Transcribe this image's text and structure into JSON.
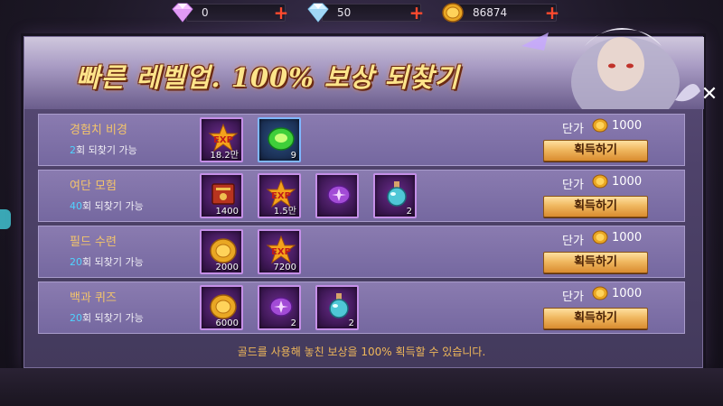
{
  "currencies": [
    {
      "name": "crystal",
      "icon": "pink-crystal-icon",
      "value": "0"
    },
    {
      "name": "diamond",
      "icon": "diamond-icon",
      "value": "50"
    },
    {
      "name": "gold",
      "icon": "gold-coin-icon",
      "value": "86874"
    }
  ],
  "title": "빠른 레벨업. 100% 보상 되찾기",
  "close_label": "✕",
  "price_label": "단가",
  "button_label": "획득하기",
  "rows": [
    {
      "name": "경험치 비경",
      "count": "2",
      "count_suffix": "회 되찾기 가능",
      "price": "1000",
      "items": [
        {
          "icon": "exp-star-icon",
          "qty": "18.2만",
          "rarity": "purple"
        },
        {
          "icon": "green-gem-icon",
          "qty": "9",
          "rarity": "blue"
        }
      ]
    },
    {
      "name": "여단 모험",
      "count": "40",
      "count_suffix": "회 되찾기 가능",
      "price": "1000",
      "items": [
        {
          "icon": "red-book-icon",
          "qty": "1400",
          "rarity": "purple"
        },
        {
          "icon": "exp-star-icon",
          "qty": "1.5만",
          "rarity": "purple"
        },
        {
          "icon": "purple-orb-icon",
          "qty": "",
          "rarity": "purple"
        },
        {
          "icon": "potion-icon",
          "qty": "2",
          "rarity": "purple"
        }
      ]
    },
    {
      "name": "필드 수련",
      "count": "20",
      "count_suffix": "회 되찾기 가능",
      "price": "1000",
      "items": [
        {
          "icon": "gold-coin-icon",
          "qty": "2000",
          "rarity": "purple"
        },
        {
          "icon": "exp-star-icon",
          "qty": "7200",
          "rarity": "purple"
        }
      ]
    },
    {
      "name": "백과 퀴즈",
      "count": "20",
      "count_suffix": "회 되찾기 가능",
      "price": "1000",
      "items": [
        {
          "icon": "gold-coin-icon",
          "qty": "6000",
          "rarity": "purple"
        },
        {
          "icon": "purple-orb-icon",
          "qty": "2",
          "rarity": "purple"
        },
        {
          "icon": "potion-icon",
          "qty": "2",
          "rarity": "purple"
        }
      ]
    }
  ],
  "footer": "골드를 사용해 놓친 보상을 100% 획득할 수 있습니다.",
  "colors": {
    "title": "#fde48a",
    "name": "#f3c46b",
    "count_num": "#4fd3ff",
    "button": "#f0b860",
    "footer": "#f0b85a"
  }
}
